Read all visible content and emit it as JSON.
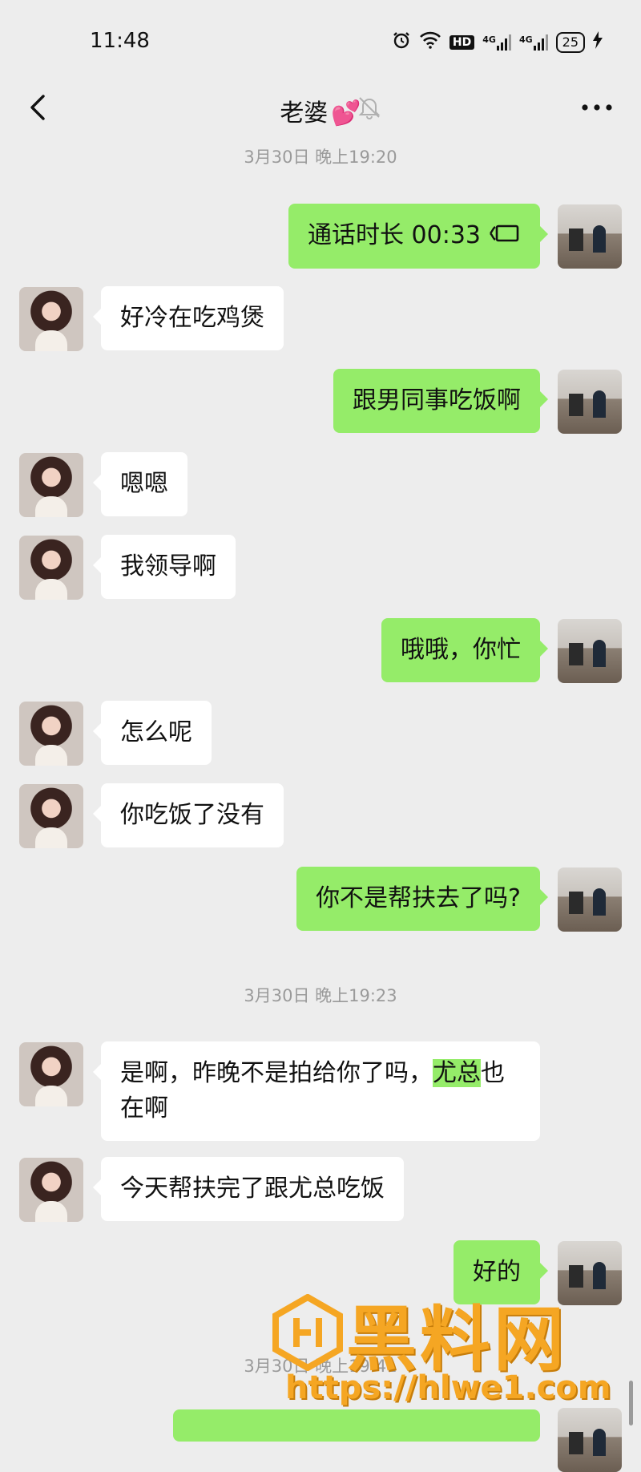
{
  "status_bar": {
    "time": "11:48",
    "icons": [
      "alarm-icon",
      "wifi-icon",
      "hd-icon",
      "signal-4g-icon",
      "signal-4g-icon"
    ],
    "hd_label": "HD",
    "net1": "4G",
    "net2": "4G",
    "battery": "25"
  },
  "nav": {
    "title": "老婆",
    "title_emoji": "💕"
  },
  "messages": [
    {
      "type": "timestamp",
      "text": "3月30日 晚上19:20"
    },
    {
      "type": "call",
      "side": "right",
      "text": "通话时长 00:33"
    },
    {
      "type": "text",
      "side": "left",
      "text": "好冷在吃鸡煲"
    },
    {
      "type": "text",
      "side": "right",
      "text": "跟男同事吃饭啊"
    },
    {
      "type": "text",
      "side": "left",
      "text": "嗯嗯"
    },
    {
      "type": "text",
      "side": "left",
      "text": "我领导啊"
    },
    {
      "type": "text",
      "side": "right",
      "text": "哦哦，你忙"
    },
    {
      "type": "text",
      "side": "left",
      "text": "怎么呢"
    },
    {
      "type": "text",
      "side": "left",
      "text": "你吃饭了没有"
    },
    {
      "type": "text",
      "side": "right",
      "text": "你不是帮扶去了吗?"
    },
    {
      "type": "timestamp",
      "text": "3月30日 晚上19:23"
    },
    {
      "type": "text",
      "side": "left",
      "text_before": "是啊，昨晚不是拍给你了吗，",
      "highlight": "尤总",
      "text_after": "也在啊"
    },
    {
      "type": "text",
      "side": "left",
      "text": "今天帮扶完了跟尤总吃饭"
    },
    {
      "type": "text",
      "side": "right",
      "text": "好的"
    },
    {
      "type": "timestamp",
      "text": "3月30日 晚上19:41"
    }
  ],
  "watermark": {
    "title": "黑料网",
    "url": "https://hlwe1.com",
    "color": "#f5a623"
  },
  "colors": {
    "background": "#ededed",
    "sent_bubble": "#95ec69",
    "received_bubble": "#ffffff"
  }
}
